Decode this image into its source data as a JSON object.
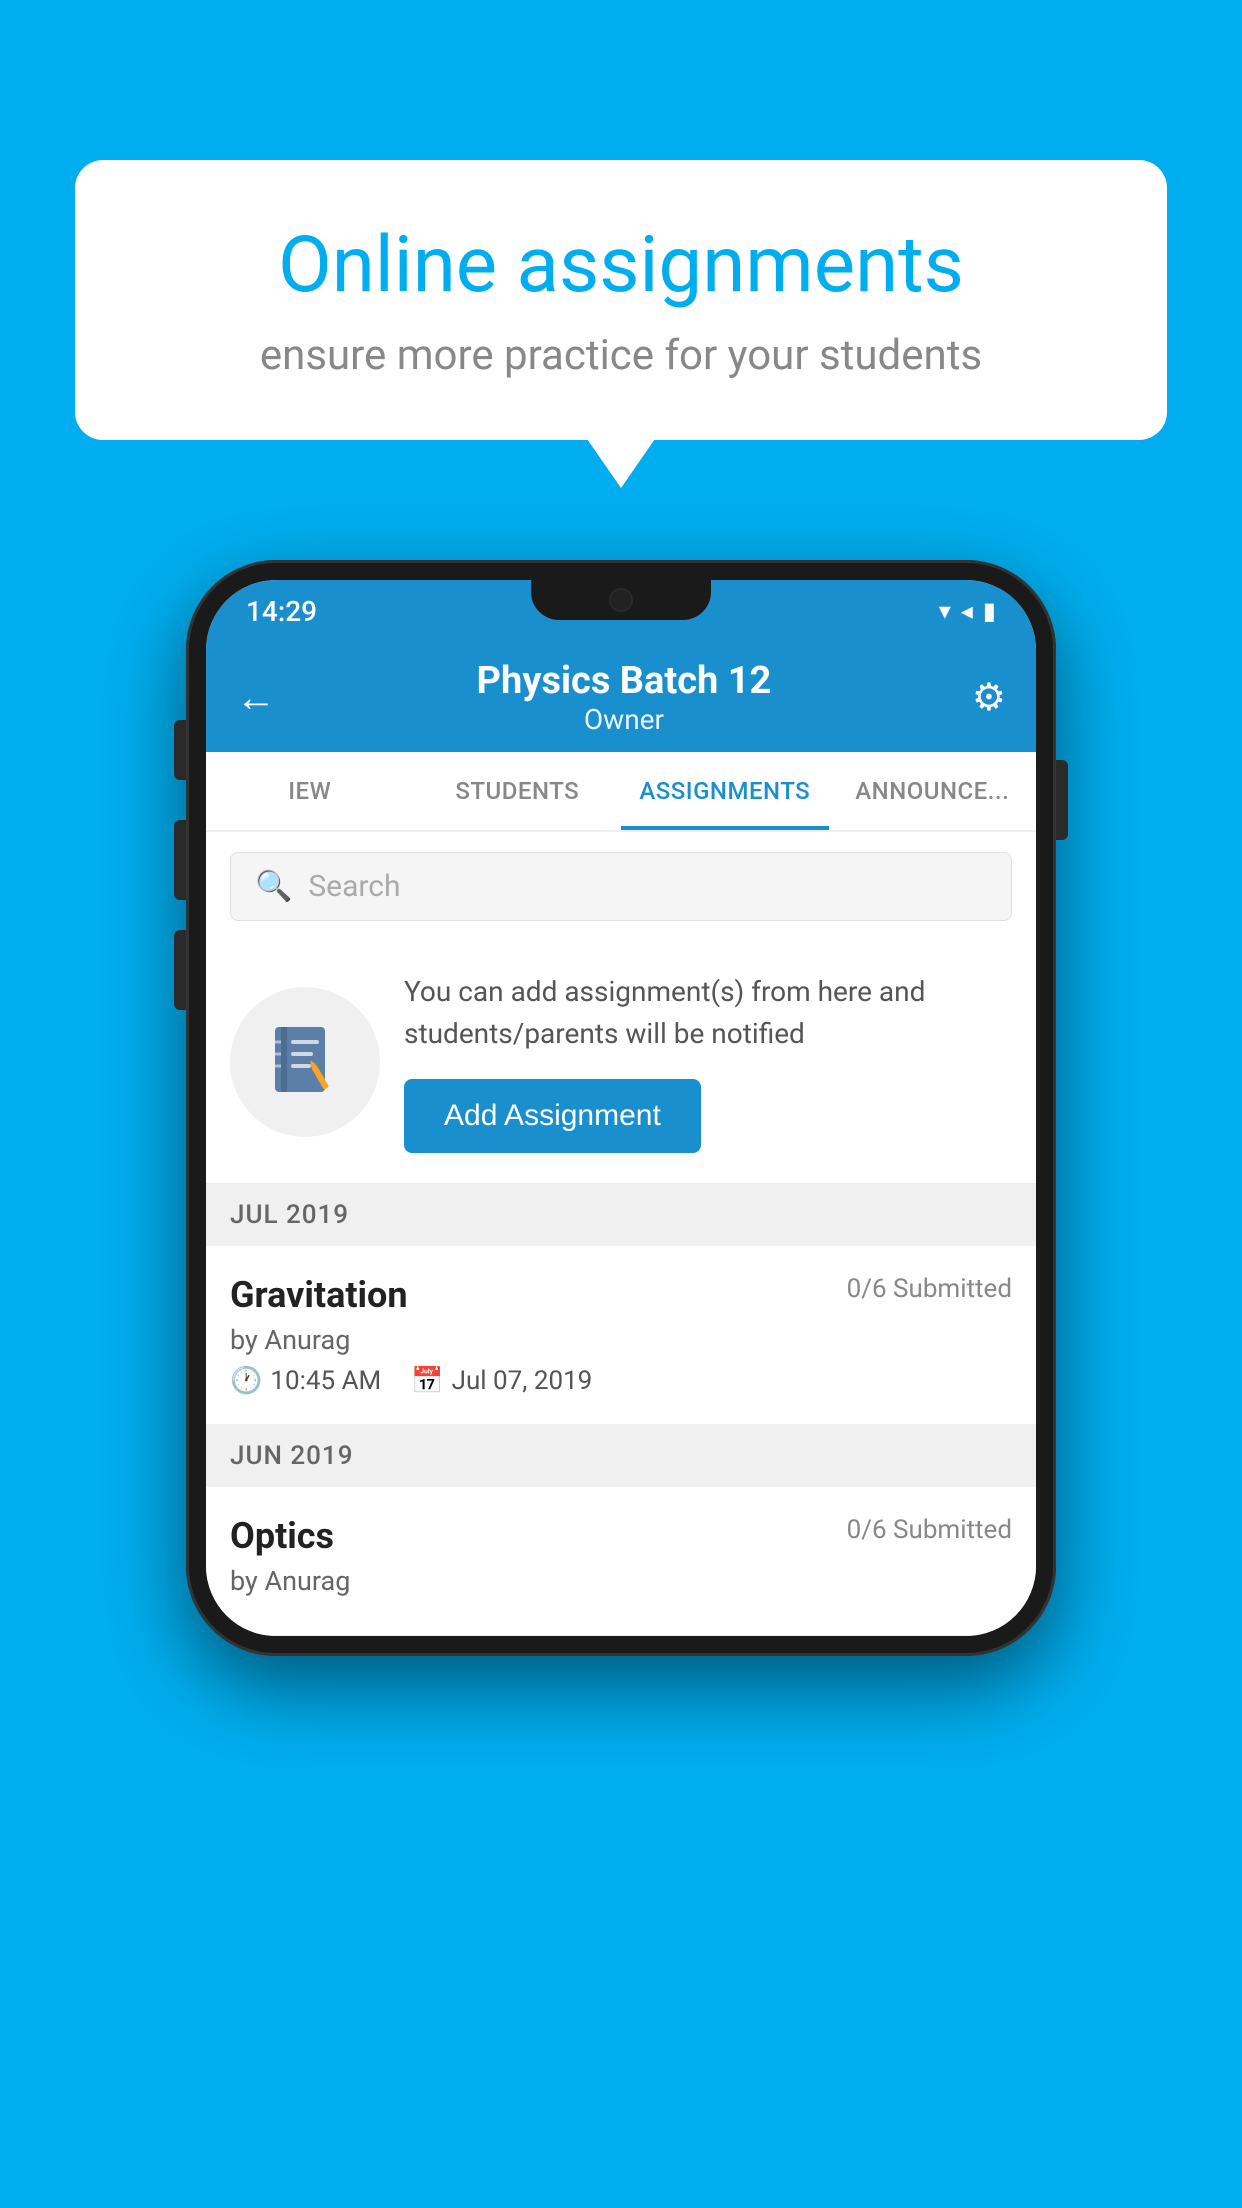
{
  "background_color": "#00AEEF",
  "speech_bubble": {
    "title": "Online assignments",
    "subtitle": "ensure more practice for your students"
  },
  "phone": {
    "status_bar": {
      "time": "14:29",
      "icons": [
        "▾",
        "◂",
        "▮"
      ]
    },
    "header": {
      "title": "Physics Batch 12",
      "subtitle": "Owner",
      "back_label": "←",
      "settings_label": "⚙"
    },
    "tabs": [
      {
        "label": "IEW",
        "active": false
      },
      {
        "label": "STUDENTS",
        "active": false
      },
      {
        "label": "ASSIGNMENTS",
        "active": true
      },
      {
        "label": "ANNOUNCE...",
        "active": false
      }
    ],
    "search": {
      "placeholder": "Search"
    },
    "add_assignment_card": {
      "description": "You can add assignment(s) from here and students/parents will be notified",
      "button_label": "Add Assignment"
    },
    "sections": [
      {
        "header": "JUL 2019",
        "items": [
          {
            "name": "Gravitation",
            "submitted": "0/6 Submitted",
            "by": "by Anurag",
            "time": "10:45 AM",
            "date": "Jul 07, 2019"
          }
        ]
      },
      {
        "header": "JUN 2019",
        "items": [
          {
            "name": "Optics",
            "submitted": "0/6 Submitted",
            "by": "by Anurag",
            "time": "",
            "date": ""
          }
        ]
      }
    ]
  }
}
